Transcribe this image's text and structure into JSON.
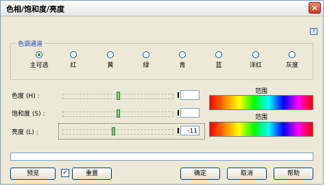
{
  "window": {
    "title": "色相/饱和度/亮度",
    "close": "✕"
  },
  "help_icon": "?",
  "channel_group": {
    "legend": "色调通道",
    "options": [
      {
        "label": "主可选",
        "checked": true
      },
      {
        "label": "红",
        "checked": false
      },
      {
        "label": "黄",
        "checked": false
      },
      {
        "label": "绿",
        "checked": false
      },
      {
        "label": "青",
        "checked": false
      },
      {
        "label": "蓝",
        "checked": false
      },
      {
        "label": "洋红",
        "checked": false
      },
      {
        "label": "灰度",
        "checked": false
      }
    ]
  },
  "sliders": [
    {
      "label": "色度 (H) :",
      "value": "",
      "level": 0.5
    },
    {
      "label": "饱和度 (S) :",
      "value": "",
      "level": 0.5
    },
    {
      "label": "亮度 (L) :",
      "value": "-11",
      "level": 0.46
    }
  ],
  "spectrum": {
    "before_label": "范围",
    "after_label": "范围"
  },
  "buttons": {
    "preview": "预览",
    "preview_checkbox": "✓",
    "reset": "重置",
    "ok": "确定",
    "cancel": "取消",
    "help": "帮助"
  },
  "colors": {
    "accent": "#1f44b3",
    "thumb": "#8cc78c"
  }
}
